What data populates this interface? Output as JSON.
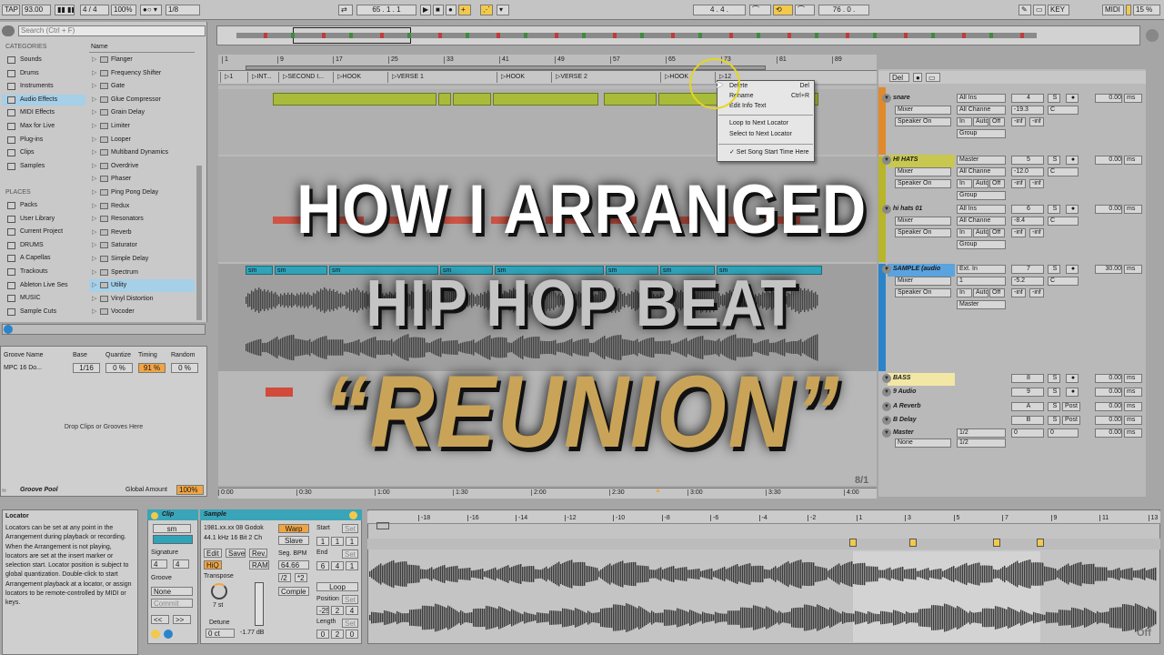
{
  "transport": {
    "tap": "TAP",
    "tempo": "93.00",
    "signature": "4 / 4",
    "zoom": "100%",
    "quant": "1/8",
    "position": "65 . 1 . 1",
    "loop_start": "4 . 4 .",
    "loop_len": "76 . 0 .",
    "key": "KEY",
    "midi": "MIDI",
    "cpu": "15 %"
  },
  "browser": {
    "search_placeholder": "Search (Ctrl + F)",
    "categories_heading": "CATEGORIES",
    "categories": [
      "Sounds",
      "Drums",
      "Instruments",
      "Audio Effects",
      "MIDI Effects",
      "Max for Live",
      "Plug-ins",
      "Clips",
      "Samples"
    ],
    "places_heading": "PLACES",
    "places": [
      "Packs",
      "User Library",
      "Current Project",
      "DRUMS",
      "A Capellas",
      "Trackouts",
      "Ableton Live Ses",
      "MUSIC",
      "Sample Cuts"
    ],
    "name_header": "Name",
    "devices": [
      "Flanger",
      "Frequency Shifter",
      "Gate",
      "Glue Compressor",
      "Grain Delay",
      "Limiter",
      "Looper",
      "Multiband Dynamics",
      "Overdrive",
      "Phaser",
      "Ping Pong Delay",
      "Redux",
      "Resonators",
      "Reverb",
      "Saturator",
      "Simple Delay",
      "Spectrum",
      "Utility",
      "Vinyl Distortion",
      "Vocoder"
    ]
  },
  "groove": {
    "headers": [
      "Groove Name",
      "Base",
      "Quantize",
      "Timing",
      "Random"
    ],
    "row": [
      "MPC 16 Do...",
      "1/16",
      "0 %",
      "91 %",
      "0 %"
    ],
    "drop_text": "Drop Clips or Grooves Here",
    "pool_label": "Groove Pool",
    "global_amount_label": "Global Amount",
    "global_amount": "100%"
  },
  "ruler": {
    "bars": [
      "1",
      "9",
      "17",
      "25",
      "33",
      "41",
      "49",
      "57",
      "65",
      "73",
      "81",
      "89"
    ],
    "times": [
      "0:00",
      "0:30",
      "1:00",
      "1:30",
      "2:00",
      "2:30",
      "3:00",
      "3:30",
      "4:00"
    ],
    "zoom_label": "8/1"
  },
  "locators": [
    "1",
    "INT...",
    "SECOND I...",
    "HOOK",
    "VERSE 1",
    "HOOK",
    "VERSE 2",
    "HOOK",
    "12"
  ],
  "context_menu": {
    "items": [
      {
        "label": "Delete",
        "key": "Del"
      },
      {
        "label": "Rename",
        "key": "Ctrl+R"
      },
      {
        "label": "Edit Info Text",
        "key": ""
      },
      {
        "label": "Loop to Next Locator",
        "key": ""
      },
      {
        "label": "Select to Next Locator",
        "key": ""
      },
      {
        "label": "✓ Set Song Start Time Here",
        "key": ""
      }
    ]
  },
  "clip_label": "sm",
  "mixer": {
    "tracks": [
      {
        "name": "snare",
        "input": "All Ins",
        "channel": "Mixer",
        "output": "Speaker On",
        "vol": "-19.3",
        "pan": "C",
        "num": "4",
        "delay": "0.00"
      },
      {
        "name": "HI HATS",
        "input": "Master",
        "channel": "Mixer",
        "output": "Speaker On",
        "vol": "-12.0",
        "pan": "C",
        "num": "5",
        "delay": "0.00"
      },
      {
        "name": "hi hats 01",
        "input": "All Ins",
        "channel": "Mixer",
        "output": "Speaker On",
        "vol": "-8.4",
        "pan": "C",
        "num": "6",
        "delay": "0.00"
      },
      {
        "name": "SAMPLE (audio",
        "input": "Ext. In",
        "channel": "Mixer",
        "output": "Speaker On",
        "vol": "-5.2",
        "pan": "C",
        "num": "7",
        "delay": "30.00"
      },
      {
        "name": "BASS",
        "input": "",
        "channel": "",
        "output": "",
        "vol": "",
        "pan": "",
        "num": "8",
        "delay": "0.00"
      },
      {
        "name": "9 Audio",
        "input": "",
        "channel": "",
        "output": "",
        "vol": "",
        "pan": "",
        "num": "9",
        "delay": "0.00"
      },
      {
        "name": "A Reverb",
        "input": "",
        "channel": "",
        "output": "",
        "vol": "",
        "pan": "",
        "num": "A",
        "delay": "0.00"
      },
      {
        "name": "B Delay",
        "input": "",
        "channel": "",
        "output": "",
        "vol": "",
        "pan": "",
        "num": "B",
        "delay": "0.00"
      },
      {
        "name": "Master",
        "input": "1/2",
        "channel": "",
        "output": "None",
        "vol": "0",
        "pan": "0",
        "num": "",
        "delay": "0.00"
      }
    ],
    "misc": {
      "all_channels": "All Channe",
      "group": "Group",
      "in": "In",
      "auto": "Auto",
      "off": "Off",
      "inf": "-inf",
      "s": "S",
      "ms": "ms",
      "post": "Post"
    }
  },
  "info": {
    "title": "Locator",
    "body": "Locators can be set at any point in the Arrangement during playback or recording. When the Arrangement is not playing, locators are set at the insert marker or selection start. Locator position is subject to global quantization. Double-click to start Arrangement playback at a locator, or assign locators to be remote-controlled by MIDI or keys."
  },
  "clip_view": {
    "clip_title": "Clip",
    "clip_name": "sm",
    "signature_label": "Signature",
    "sig_num": "4",
    "sig_den": "4",
    "groove_label": "Groove",
    "groove_val": "None",
    "commit": "Commit",
    "sample_title": "Sample",
    "file": "1981.xx.xx 08 Godok",
    "format": "44.1 kHz 16 Bit 2 Ch",
    "warp": "Warp",
    "slave": "Slave",
    "edit": "Edit",
    "save": "Save",
    "rev": "Rev.",
    "hiq": "HiQ",
    "ram": "RAM",
    "seg_bpm_label": "Seg. BPM",
    "seg_bpm": "64.66",
    "transpose_label": "Transpose",
    "transpose_val": "7 st",
    "detune_label": "Detune",
    "detune_val": "0 ct",
    "gain_val": "-1.77 dB",
    "mode": "Comple",
    "start_label": "Start",
    "end_label": "End",
    "loop_label": "Loop",
    "position_label": "Position",
    "length_label": "Length",
    "set_label": "Set",
    "start_vals": [
      "1",
      "1",
      "1"
    ],
    "end_vals": [
      "6",
      "4",
      "1"
    ],
    "position_vals": [
      "-25",
      "2",
      "4"
    ],
    "length_vals": [
      "0",
      "2",
      "0"
    ],
    "half": "/2",
    "dbl": "*2"
  },
  "sample_ruler": [
    "-18",
    "-16",
    "-14",
    "-12",
    "-10",
    "-8",
    "-6",
    "-4",
    "-2",
    "1",
    "3",
    "5",
    "7",
    "9",
    "11",
    "13"
  ],
  "sample_off": "Off",
  "overlay": {
    "line1": "HOW I ARRANGED",
    "line2": "HIP HOP BEAT",
    "line3": "“REUNION”"
  },
  "colors": {
    "accent_orange": "#f0a542",
    "title_gold": "#c9a458",
    "title_white": "#ffffff",
    "title_gray": "#bdbdbd",
    "clip_green": "#a9bc3a",
    "clip_teal": "#2fa3b8",
    "yellow_sel": "#f2c94c"
  }
}
